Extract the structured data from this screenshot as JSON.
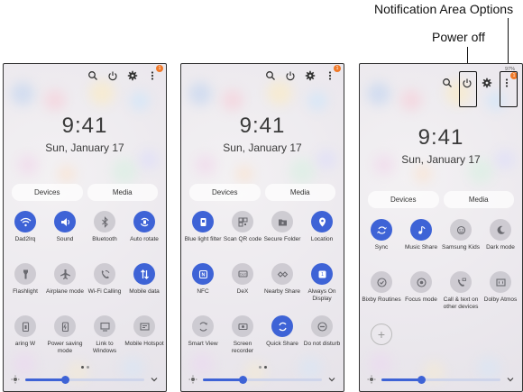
{
  "callouts": {
    "notification_options": "Notification Area Options",
    "power_off": "Power off"
  },
  "clock": {
    "time": "9:41",
    "date": "Sun, January 17"
  },
  "segments": {
    "devices": "Devices",
    "media": "Media"
  },
  "status_bar": {
    "battery": "97%"
  },
  "badge_count": "1",
  "brightness_level": 0.33,
  "colors": {
    "accent": "#3e63d6",
    "tile_off": "#c8c6cc",
    "badge": "#f07a2a"
  },
  "panels": [
    {
      "tiles": [
        {
          "label": "Dad2lrq",
          "icon": "wifi-icon",
          "on": true
        },
        {
          "label": "Sound",
          "icon": "sound-icon",
          "on": true
        },
        {
          "label": "Bluetooth",
          "icon": "bluetooth-icon",
          "on": false
        },
        {
          "label": "Auto rotate",
          "icon": "auto-rotate-icon",
          "on": true
        },
        {
          "label": "Flashlight",
          "icon": "flashlight-icon",
          "on": false
        },
        {
          "label": "Airplane mode",
          "icon": "airplane-icon",
          "on": false
        },
        {
          "label": "Wi-Fi Calling",
          "icon": "wifi-calling-icon",
          "on": false
        },
        {
          "label": "Mobile data",
          "icon": "mobile-data-icon",
          "on": true
        },
        {
          "label": "aring W",
          "icon": "hotspot-sharing-icon",
          "on": false
        },
        {
          "label": "Power saving mode",
          "icon": "power-saving-icon",
          "on": false
        },
        {
          "label": "Link to Windows",
          "icon": "link-windows-icon",
          "on": false
        },
        {
          "label": "Mobile Hotspot",
          "icon": "hotspot-icon",
          "on": false
        }
      ]
    },
    {
      "tiles": [
        {
          "label": "Blue light filter",
          "icon": "blue-light-icon",
          "on": true
        },
        {
          "label": "Scan QR code",
          "icon": "qr-code-icon",
          "on": false
        },
        {
          "label": "Secure Folder",
          "icon": "secure-folder-icon",
          "on": false
        },
        {
          "label": "Location",
          "icon": "location-icon",
          "on": true
        },
        {
          "label": "NFC",
          "icon": "nfc-icon",
          "on": true
        },
        {
          "label": "DeX",
          "icon": "dex-icon",
          "on": false
        },
        {
          "label": "Nearby Share",
          "icon": "nearby-share-icon",
          "on": false
        },
        {
          "label": "Always On Display",
          "icon": "always-on-display-icon",
          "on": true
        },
        {
          "label": "Smart View",
          "icon": "smart-view-icon",
          "on": false
        },
        {
          "label": "Screen recorder",
          "icon": "screen-recorder-icon",
          "on": false
        },
        {
          "label": "Quick Share",
          "icon": "quick-share-icon",
          "on": true
        },
        {
          "label": "Do not disturb",
          "icon": "do-not-disturb-icon",
          "on": false
        }
      ]
    },
    {
      "tiles": [
        {
          "label": "Sync",
          "icon": "sync-icon",
          "on": true
        },
        {
          "label": "Music Share",
          "icon": "music-share-icon",
          "on": true
        },
        {
          "label": "Samsung Kids",
          "icon": "samsung-kids-icon",
          "on": false
        },
        {
          "label": "Dark mode",
          "icon": "dark-mode-icon",
          "on": false
        },
        {
          "label": "Bixby Routines",
          "icon": "bixby-routines-icon",
          "on": false
        },
        {
          "label": "Focus mode",
          "icon": "focus-mode-icon",
          "on": false
        },
        {
          "label": "Call & text on other devices",
          "icon": "call-text-icon",
          "on": false
        },
        {
          "label": "Dolby Atmos",
          "icon": "dolby-atmos-icon",
          "on": false
        }
      ]
    }
  ]
}
